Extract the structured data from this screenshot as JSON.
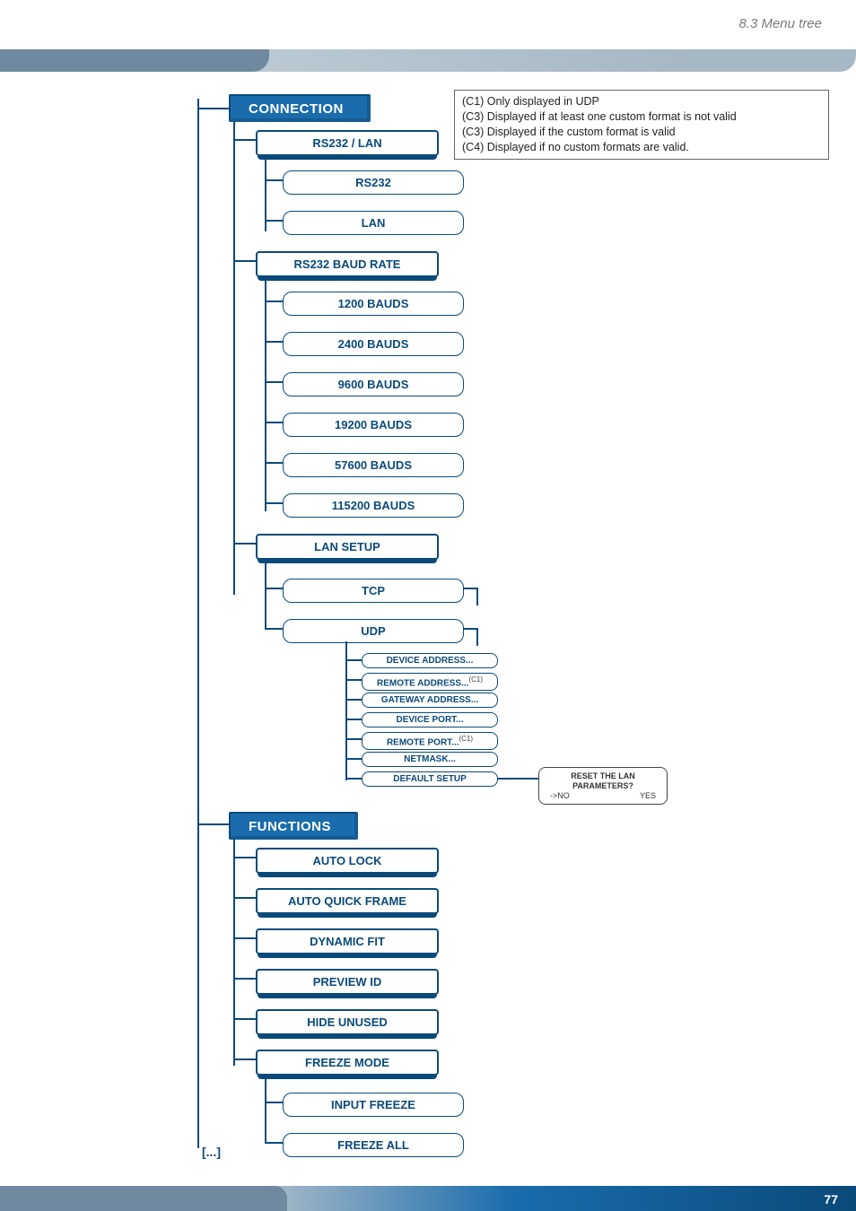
{
  "page": {
    "section": "8.3 Menu tree",
    "number": "77",
    "continuation": "[...]"
  },
  "legend": {
    "l1": "(C1) Only displayed in UDP",
    "l2": "(C3) Displayed if at least one custom format is not valid",
    "l3": "(C3) Displayed if the custom format is valid",
    "l4": "(C4) Displayed if no custom formats are valid."
  },
  "tree": {
    "connection": {
      "label": "CONNECTION",
      "rs232lan": {
        "label": "RS232 / LAN",
        "opt1": "RS232",
        "opt2": "LAN"
      },
      "baud": {
        "label": "RS232 BAUD RATE",
        "b1": "1200 BAUDS",
        "b2": "2400 BAUDS",
        "b3": "9600 BAUDS",
        "b4": "19200 BAUDS",
        "b5": "57600 BAUDS",
        "b6": "115200 BAUDS"
      },
      "lansetup": {
        "label": "LAN SETUP",
        "p1": "TCP",
        "p2": "UDP",
        "s1": "DEVICE ADDRESS...",
        "s2": "REMOTE ADDRESS...",
        "s2note": "(C1)",
        "s3": "GATEWAY ADDRESS...",
        "s4": "DEVICE PORT...",
        "s5": "REMOTE PORT...",
        "s5note": "(C1)",
        "s6": "NETMASK...",
        "s7": "DEFAULT SETUP",
        "reset": {
          "title": "RESET THE LAN PARAMETERS?",
          "no": "->NO",
          "yes": "YES"
        }
      }
    },
    "functions": {
      "label": "FUNCTIONS",
      "f1": "AUTO LOCK",
      "f2": "AUTO QUICK FRAME",
      "f3": "DYNAMIC FIT",
      "f4": "PREVIEW ID",
      "f5": "HIDE UNUSED",
      "freeze": {
        "label": "FREEZE MODE",
        "m1": "INPUT FREEZE",
        "m2": "FREEZE ALL"
      }
    }
  }
}
